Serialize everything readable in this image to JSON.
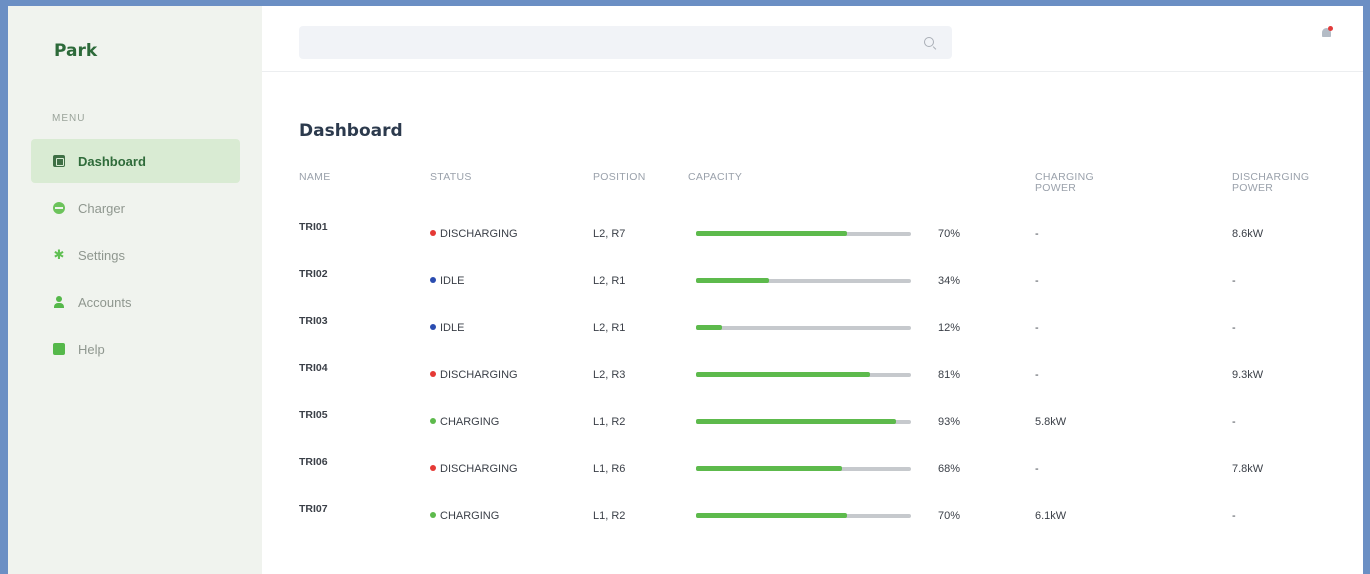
{
  "app": {
    "brand": "Park"
  },
  "sidebar": {
    "menu_label": "MENU",
    "items": [
      {
        "label": "Dashboard",
        "icon": "dashboard-icon",
        "active": true
      },
      {
        "label": "Charger",
        "icon": "charger-icon",
        "active": false
      },
      {
        "label": "Settings",
        "icon": "settings-icon",
        "active": false
      },
      {
        "label": "Accounts",
        "icon": "accounts-icon",
        "active": false
      },
      {
        "label": "Help",
        "icon": "help-icon",
        "active": false
      }
    ]
  },
  "header": {
    "search": {
      "placeholder": "",
      "value": ""
    },
    "notification_icon": "bell-icon"
  },
  "main": {
    "title": "Dashboard",
    "columns": {
      "name": "NAME",
      "status": "STATUS",
      "position": "POSITION",
      "capacity": "CAPACITY",
      "charging_power_l1": "CHARGING",
      "charging_power_l2": "POWER",
      "discharging_power_l1": "DISCHARGING",
      "discharging_power_l2": "POWER"
    },
    "rows": [
      {
        "name": "TRI01",
        "status": "DISCHARGING",
        "position": "L2, R7",
        "capacity": 70,
        "capacity_label": "70%",
        "charging_power": "-",
        "discharging_power": "8.6kW"
      },
      {
        "name": "TRI02",
        "status": "IDLE",
        "position": "L2, R1",
        "capacity": 34,
        "capacity_label": "34%",
        "charging_power": "-",
        "discharging_power": "-"
      },
      {
        "name": "TRI03",
        "status": "IDLE",
        "position": "L2, R1",
        "capacity": 12,
        "capacity_label": "12%",
        "charging_power": "-",
        "discharging_power": "-"
      },
      {
        "name": "TRI04",
        "status": "DISCHARGING",
        "position": "L2, R3",
        "capacity": 81,
        "capacity_label": "81%",
        "charging_power": "-",
        "discharging_power": "9.3kW"
      },
      {
        "name": "TRI05",
        "status": "CHARGING",
        "position": "L1, R2",
        "capacity": 93,
        "capacity_label": "93%",
        "charging_power": "5.8kW",
        "discharging_power": "-"
      },
      {
        "name": "TRI06",
        "status": "DISCHARGING",
        "position": "L1, R6",
        "capacity": 68,
        "capacity_label": "68%",
        "charging_power": "-",
        "discharging_power": "7.8kW"
      },
      {
        "name": "TRI07",
        "status": "CHARGING",
        "position": "L1, R2",
        "capacity": 70,
        "capacity_label": "70%",
        "charging_power": "6.1kW",
        "discharging_power": "-"
      }
    ]
  },
  "colors": {
    "DISCHARGING": "#e53935",
    "IDLE": "#2a4cb0",
    "CHARGING": "#5dba4c",
    "accent": "#2f6b3a",
    "sidebar_bg": "#f0f3ee"
  }
}
